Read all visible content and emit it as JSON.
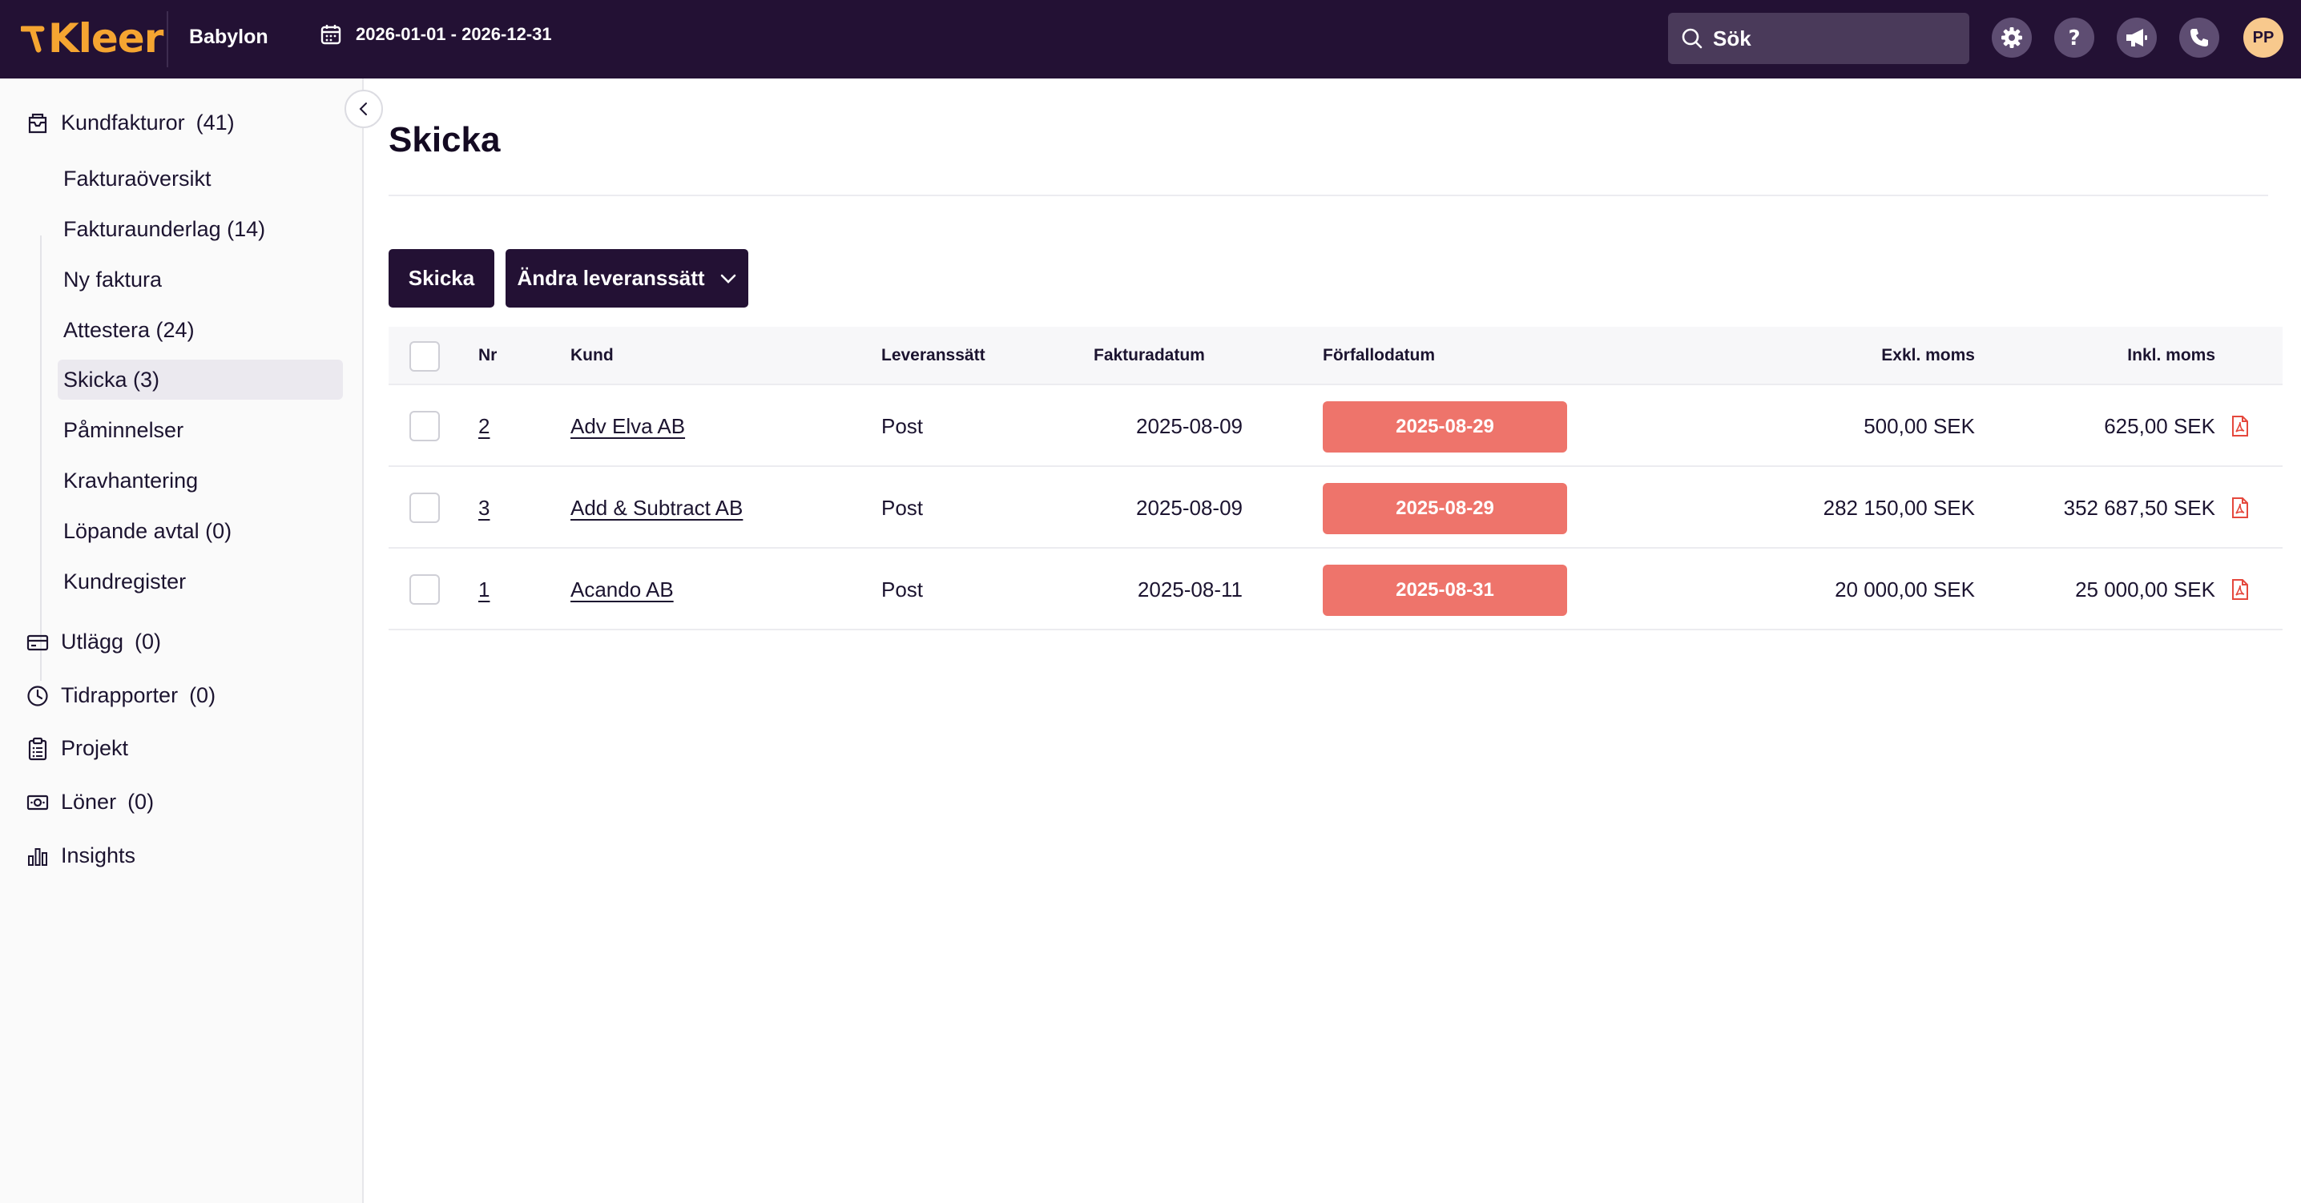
{
  "header": {
    "logo": "Kleer",
    "company": "Babylon",
    "period": "2026-01-01 - 2026-12-31",
    "search_placeholder": "Sök",
    "avatar_initials": "PP",
    "icons": [
      "gear-icon",
      "help-icon",
      "megaphone-icon",
      "phone-icon"
    ]
  },
  "sidebar": {
    "kundfakturor": {
      "label": "Kundfakturor",
      "count": "(41)"
    },
    "sub_items": [
      {
        "label": "Fakturaöversikt"
      },
      {
        "label": "Fakturaunderlag (14)"
      },
      {
        "label": "Ny faktura"
      },
      {
        "label": "Attestera (24)"
      },
      {
        "label": "Skicka (3)",
        "active": true
      },
      {
        "label": "Påminnelser"
      },
      {
        "label": "Kravhantering"
      },
      {
        "label": "Löpande avtal (0)"
      },
      {
        "label": "Kundregister"
      }
    ],
    "utlagg": {
      "label": "Utlägg",
      "count": "(0)"
    },
    "tidrapporter": {
      "label": "Tidrapporter",
      "count": "(0)"
    },
    "projekt": {
      "label": "Projekt"
    },
    "loner": {
      "label": "Löner",
      "count": "(0)"
    },
    "insights": {
      "label": "Insights"
    }
  },
  "main": {
    "title": "Skicka",
    "send_button": "Skicka",
    "change_delivery_button": "Ändra leveranssätt",
    "columns": {
      "nr": "Nr",
      "kund": "Kund",
      "leveranssatt": "Leveranssätt",
      "fakturadatum": "Fakturadatum",
      "forfallodatum": "Förfallodatum",
      "exkl_moms": "Exkl. moms",
      "inkl_moms": "Inkl. moms"
    },
    "rows": [
      {
        "nr": "2",
        "kund": "Adv Elva AB",
        "leveranssatt": "Post",
        "fakturadatum": "2025-08-09",
        "forfallodatum": "2025-08-29",
        "exkl_moms": "500,00 SEK",
        "inkl_moms": "625,00 SEK"
      },
      {
        "nr": "3",
        "kund": "Add & Subtract AB",
        "leveranssatt": "Post",
        "fakturadatum": "2025-08-09",
        "forfallodatum": "2025-08-29",
        "exkl_moms": "282 150,00 SEK",
        "inkl_moms": "352 687,50 SEK"
      },
      {
        "nr": "1",
        "kund": "Acando AB",
        "leveranssatt": "Post",
        "fakturadatum": "2025-08-11",
        "forfallodatum": "2025-08-31",
        "exkl_moms": "20 000,00 SEK",
        "inkl_moms": "25 000,00 SEK"
      }
    ]
  },
  "colors": {
    "topbar": "#231134",
    "logo": "#f5a531",
    "overdue_badge": "#ee746b",
    "pdf_icon": "#e5483d",
    "avatar": "#f8c98d"
  }
}
